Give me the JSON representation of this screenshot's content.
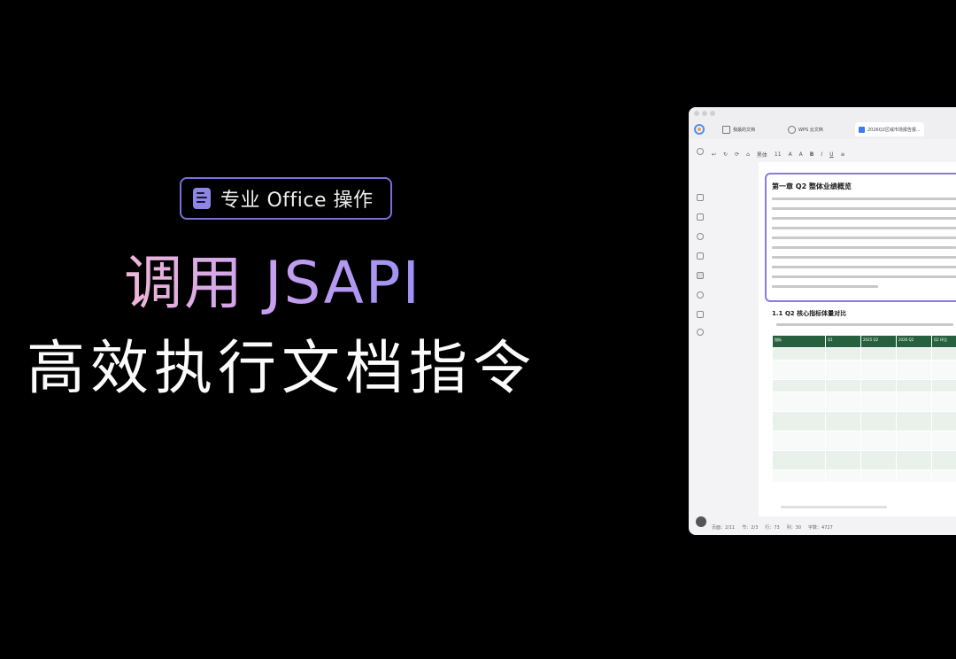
{
  "promo": {
    "badge_label": "专业 Office 操作",
    "headline_line1": "调用 JSAPI",
    "headline_line2": "高效执行文档指令"
  },
  "app": {
    "tabs": [
      {
        "label": "我最的文档",
        "active": false
      },
      {
        "label": "WPS 云文档",
        "active": false
      },
      {
        "label": "2026Q2区域市场报告报...",
        "active": true
      }
    ],
    "toolbar": {
      "items": [
        "↩",
        "↻",
        "⟳",
        "⌂",
        "黑体",
        "11",
        "A",
        "A",
        "B",
        "I",
        "U",
        "≡"
      ]
    },
    "document": {
      "chapter_title": "第一章  Q2 整体业绩概览",
      "section_title": "1.1  Q2 核心指标体量对比",
      "table_headers": [
        "指标",
        "Q1",
        "2025 Q2",
        "2026 Q2",
        "Q2 环比"
      ],
      "table_rows": [
        [
          "",
          "",
          "",
          "",
          ""
        ],
        [
          "",
          "",
          "",
          "",
          ""
        ],
        [
          "",
          "",
          "",
          "",
          ""
        ],
        [
          "",
          "",
          "",
          "",
          ""
        ],
        [
          "",
          "",
          "",
          "",
          ""
        ],
        [
          "",
          "",
          "",
          "",
          ""
        ],
        [
          "",
          "",
          "",
          "",
          ""
        ],
        [
          "",
          "",
          "",
          "",
          ""
        ]
      ]
    },
    "statusbar": {
      "items": [
        "页面：2/11",
        "节：2/3",
        "行：73",
        "列：30",
        "字数：4727"
      ]
    }
  },
  "colors": {
    "background": "#000000",
    "badge_border": "#7a6fd8",
    "headline_gradient_start": "#f0b7d8",
    "headline_gradient_end": "#9c90f2",
    "highlight_border": "#8b7ae6",
    "table_header": "#27603f",
    "table_row_tint": "#e8f1ea"
  },
  "icons": {
    "badge": "document-icon",
    "apps": "apps-icon"
  }
}
